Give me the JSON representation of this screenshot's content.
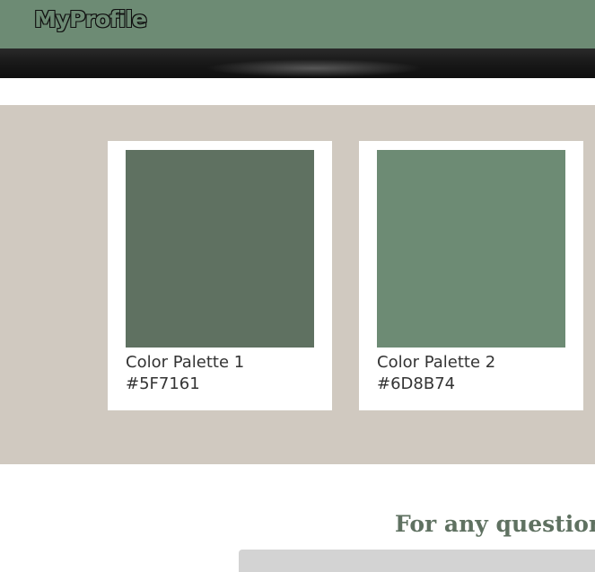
{
  "header": {
    "logo_text": "MyProfile"
  },
  "palettes": [
    {
      "name": "Color Palette 1",
      "hex": "#5F7161"
    },
    {
      "name": "Color Palette 2",
      "hex": "#6D8B74"
    }
  ],
  "contact": {
    "heading": "For any question"
  },
  "colors": {
    "header_bg": "#6D8B74",
    "section_bg": "#D0C9C0",
    "heading_color": "#5F7161"
  }
}
